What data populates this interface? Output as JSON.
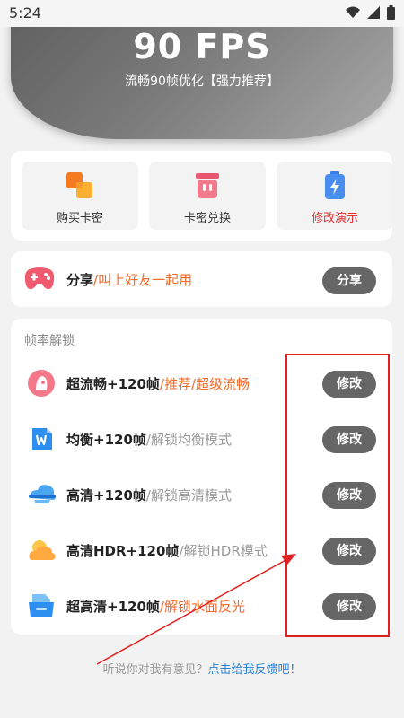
{
  "status": {
    "time": "5:24"
  },
  "hero": {
    "fps": "90 FPS",
    "subtitle": "流畅90帧优化【强力推荐】"
  },
  "quick": [
    {
      "label": "购买卡密",
      "icon": "squares-icon"
    },
    {
      "label": "卡密兑换",
      "icon": "bin-icon"
    },
    {
      "label": "修改演示",
      "icon": "battery-bolt-icon",
      "color": "#e03030"
    }
  ],
  "share": {
    "title": "分享",
    "desc": "/叫上好友一起用",
    "button": "分享"
  },
  "unlock": {
    "heading": "帧率解锁",
    "items": [
      {
        "title": "超流畅+120帧",
        "desc": "/推荐/超级流畅",
        "desc_color": "#f26a2a",
        "button": "修改"
      },
      {
        "title": "均衡+120帧",
        "desc": "/解锁均衡模式",
        "desc_color": "#999999",
        "button": "修改"
      },
      {
        "title": "高清+120帧",
        "desc": "/解锁高清模式",
        "desc_color": "#999999",
        "button": "修改"
      },
      {
        "title": "高清HDR+120帧",
        "desc": "/解锁HDR模式",
        "desc_color": "#999999",
        "button": "修改"
      },
      {
        "title": "超高清+120帧",
        "desc": "/解锁水面反光",
        "desc_color": "#f26a2a",
        "button": "修改"
      }
    ]
  },
  "footer": {
    "prefix": "听说你对我有意见？",
    "link": "点击给我反馈吧！"
  },
  "colors": {
    "accent": "#f26a2a",
    "button": "#666666",
    "annotation": "#e02020",
    "link": "#2a7fd6"
  }
}
